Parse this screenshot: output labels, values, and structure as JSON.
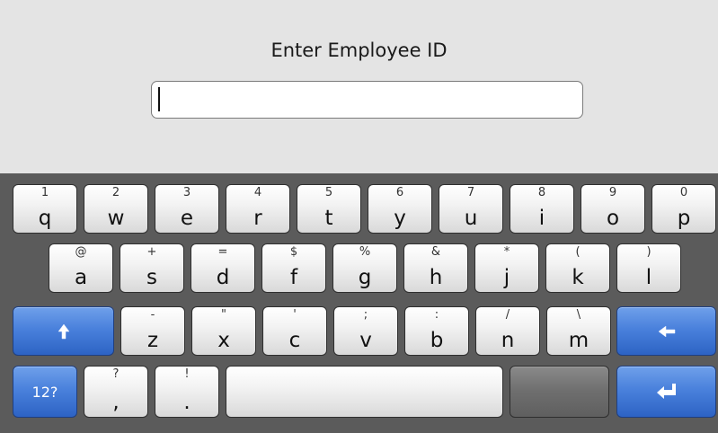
{
  "prompt": {
    "title": "Enter Employee ID"
  },
  "id_input": {
    "value": "",
    "placeholder": ""
  },
  "keyboard": {
    "row1": [
      {
        "alt": "1",
        "key": "q"
      },
      {
        "alt": "2",
        "key": "w"
      },
      {
        "alt": "3",
        "key": "e"
      },
      {
        "alt": "4",
        "key": "r"
      },
      {
        "alt": "5",
        "key": "t"
      },
      {
        "alt": "6",
        "key": "y"
      },
      {
        "alt": "7",
        "key": "u"
      },
      {
        "alt": "8",
        "key": "i"
      },
      {
        "alt": "9",
        "key": "o"
      },
      {
        "alt": "0",
        "key": "p"
      }
    ],
    "row2": [
      {
        "alt": "@",
        "key": "a"
      },
      {
        "alt": "+",
        "key": "s"
      },
      {
        "alt": "=",
        "key": "d"
      },
      {
        "alt": "$",
        "key": "f"
      },
      {
        "alt": "%",
        "key": "g"
      },
      {
        "alt": "&",
        "key": "h"
      },
      {
        "alt": "*",
        "key": "j"
      },
      {
        "alt": "(",
        "key": "k"
      },
      {
        "alt": ")",
        "key": "l"
      }
    ],
    "row3": [
      {
        "alt": "-",
        "key": "z"
      },
      {
        "alt": "\"",
        "key": "x"
      },
      {
        "alt": "'",
        "key": "c"
      },
      {
        "alt": ";",
        "key": "v"
      },
      {
        "alt": ":",
        "key": "b"
      },
      {
        "alt": "/",
        "key": "n"
      },
      {
        "alt": "\\",
        "key": "m"
      }
    ],
    "row4": {
      "mode_label": "12?",
      "comma": {
        "alt": "?",
        "key": ","
      },
      "period": {
        "alt": "!",
        "key": "."
      }
    },
    "icons": {
      "shift": "shift-arrow-up-icon",
      "backspace": "arrow-left-icon",
      "enter": "enter-return-icon"
    },
    "colors": {
      "accent_blue": "#4a81dc",
      "keyboard_bg": "#5b5b5b",
      "panel_bg": "#e4e4e4"
    }
  }
}
